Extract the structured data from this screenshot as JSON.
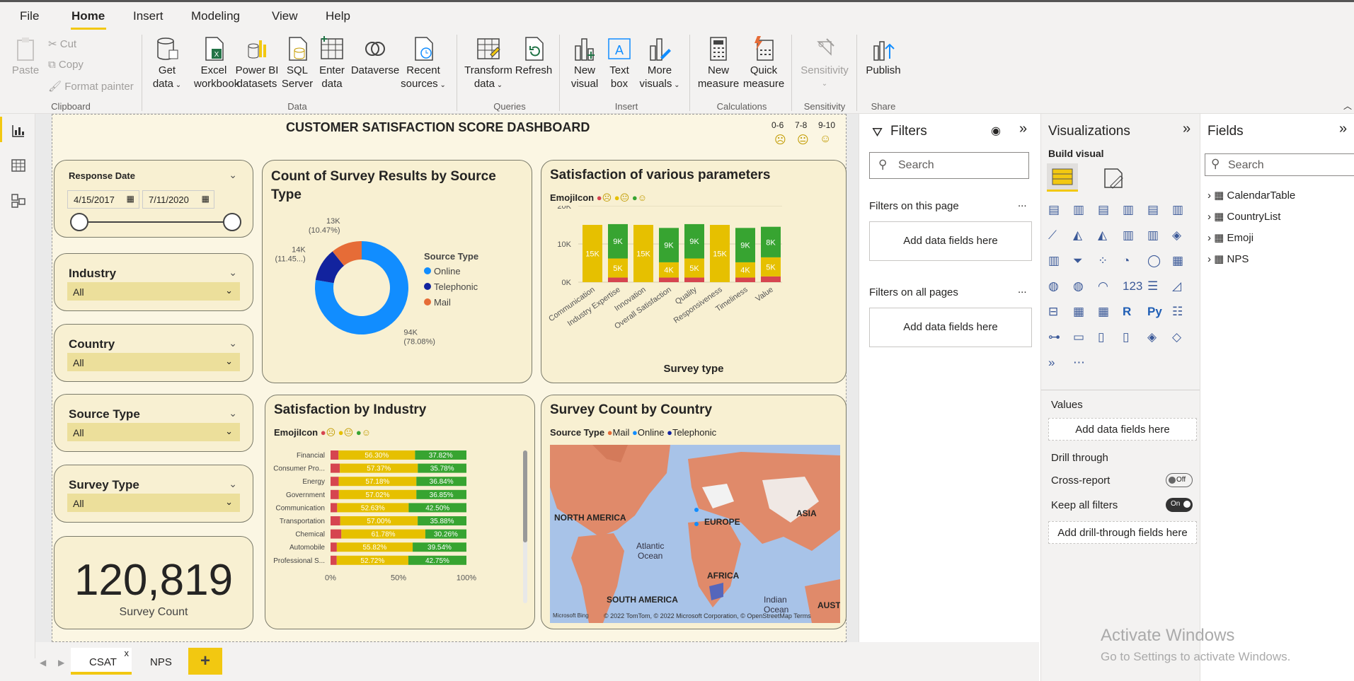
{
  "menu": {
    "items": [
      "File",
      "Home",
      "Insert",
      "Modeling",
      "View",
      "Help"
    ]
  },
  "ribbon": {
    "clipboard": {
      "paste": "Paste",
      "cut": "Cut",
      "copy": "Copy",
      "format_painter": "Format painter",
      "group": "Clipboard"
    },
    "data": {
      "get_data": [
        "Get",
        "data"
      ],
      "excel": [
        "Excel",
        "workbook"
      ],
      "powerbi": [
        "Power BI",
        "datasets"
      ],
      "sql": [
        "SQL",
        "Server"
      ],
      "enter": [
        "Enter",
        "data"
      ],
      "dataverse": "Dataverse",
      "recent": [
        "Recent",
        "sources"
      ],
      "group": "Data"
    },
    "queries": {
      "transform": [
        "Transform",
        "data"
      ],
      "refresh": "Refresh",
      "group": "Queries"
    },
    "insert": {
      "new_visual": [
        "New",
        "visual"
      ],
      "text_box": [
        "Text",
        "box"
      ],
      "more_visuals": [
        "More",
        "visuals"
      ],
      "group": "Insert"
    },
    "calculations": {
      "new_measure": [
        "New",
        "measure"
      ],
      "quick_measure": [
        "Quick",
        "measure"
      ],
      "group": "Calculations"
    },
    "sensitivity": {
      "label": "Sensitivity",
      "group": "Sensitivity"
    },
    "share": {
      "publish": "Publish",
      "group": "Share"
    }
  },
  "dashboard": {
    "title": "CUSTOMER SATISFACTION SCORE DASHBOARD",
    "legend_ranges": [
      "0-6",
      "7-8",
      "9-10"
    ],
    "slicers": {
      "date": {
        "title": "Response Date",
        "from": "4/15/2017",
        "to": "7/11/2020"
      },
      "industry": {
        "title": "Industry",
        "value": "All"
      },
      "country": {
        "title": "Country",
        "value": "All"
      },
      "source_type": {
        "title": "Source Type",
        "value": "All"
      },
      "survey_type": {
        "title": "Survey Type",
        "value": "All"
      }
    },
    "kpi": {
      "value": "120,819",
      "label": "Survey Count"
    }
  },
  "chart_data": [
    {
      "type": "pie",
      "title": "Count of Survey Results by Source Type",
      "legend_title": "Source Type",
      "categories": [
        "Online",
        "Telephonic",
        "Mail"
      ],
      "values": [
        94000,
        14000,
        13000
      ],
      "labels": [
        {
          "v": "94K",
          "p": "(78.08%)"
        },
        {
          "v": "14K",
          "p": "(11.45...)"
        },
        {
          "v": "13K",
          "p": "(10.47%)"
        }
      ],
      "colors": [
        "#118dff",
        "#12239e",
        "#e66c37"
      ]
    },
    {
      "type": "bar",
      "title": "Satisfaction of various parameters",
      "legend_title": "EmojiIcon",
      "xlabel": "Survey type",
      "categories": [
        "Communication",
        "Industry Expertise",
        "Innovation",
        "Overall Satisfaction",
        "Quality",
        "Responsiveness",
        "Timeliness",
        "Value"
      ],
      "ylim": [
        0,
        20000
      ],
      "yticks": [
        "0K",
        "10K",
        "20K"
      ],
      "series": [
        {
          "values": [
            0,
            1200,
            0,
            1200,
            1200,
            0,
            1200,
            1500
          ],
          "color": "#d64550"
        },
        {
          "values": [
            15000,
            5000,
            15000,
            4000,
            5000,
            15000,
            4000,
            5000
          ],
          "color": "#e6c000"
        },
        {
          "values": [
            0,
            9000,
            0,
            9000,
            9000,
            0,
            9000,
            8000
          ],
          "color": "#37a431"
        }
      ],
      "data_labels": [
        [
          "",
          "15K",
          ""
        ],
        [
          "",
          "5K",
          "9K"
        ],
        [
          "",
          "15K",
          ""
        ],
        [
          "",
          "4K",
          "9K"
        ],
        [
          "",
          "5K",
          "9K"
        ],
        [
          "",
          "15K",
          ""
        ],
        [
          "",
          "4K",
          "9K"
        ],
        [
          "",
          "5K",
          "8K"
        ]
      ]
    },
    {
      "type": "bar",
      "title": "Satisfaction by Industry",
      "legend_title": "EmojiIcon",
      "categories": [
        "Financial",
        "Consumer Pro...",
        "Energy",
        "Government",
        "Communication",
        "Transportation",
        "Chemical",
        "Automobile",
        "Professional S..."
      ],
      "xticks": [
        "0%",
        "50%",
        "100%"
      ],
      "series": [
        {
          "values": [
            5.88,
            6.85,
            5.98,
            6.13,
            4.87,
            7.12,
            7.96,
            4.62,
            4.53
          ],
          "color": "#d64550"
        },
        {
          "values": [
            56.3,
            57.37,
            57.18,
            57.02,
            52.63,
            57.0,
            61.78,
            55.82,
            52.72
          ],
          "labels": [
            "56.30%",
            "57.37%",
            "57.18%",
            "57.02%",
            "52.63%",
            "57.00%",
            "61.78%",
            "55.82%",
            "52.72%"
          ],
          "color": "#e6c000"
        },
        {
          "values": [
            37.82,
            35.78,
            36.84,
            36.85,
            42.5,
            35.88,
            30.26,
            39.54,
            42.75
          ],
          "labels": [
            "37.82%",
            "35.78%",
            "36.84%",
            "36.85%",
            "42.50%",
            "35.88%",
            "30.26%",
            "39.54%",
            "42.75%"
          ],
          "color": "#37a431"
        }
      ]
    }
  ],
  "map": {
    "title": "Survey Count by Country",
    "legend_title": "Source Type",
    "legend": [
      {
        "name": "Mail",
        "color": "#e66c37"
      },
      {
        "name": "Online",
        "color": "#118dff"
      },
      {
        "name": "Telephonic",
        "color": "#12239e"
      }
    ],
    "labels": [
      "NORTH AMERICA",
      "EUROPE",
      "ASIA",
      "Atlantic",
      "Ocean",
      "AFRICA",
      "SOUTH AMERICA",
      "Indian",
      "Ocean",
      "AUST"
    ],
    "credit": "© 2022 TomTom, © 2022 Microsoft Corporation, © OpenStreetMap  Terms",
    "bing": "Microsoft Bing"
  },
  "filters": {
    "title": "Filters",
    "search": "Search",
    "on_page": "Filters on this page",
    "on_all": "Filters on all pages",
    "add": "Add data fields here",
    "more": "..."
  },
  "viz": {
    "title": "Visualizations",
    "build": "Build visual",
    "values": "Values",
    "add": "Add data fields here",
    "drill": "Drill through",
    "cross": "Cross-report",
    "cross_state": "Off",
    "keep": "Keep all filters",
    "keep_state": "On",
    "add_drill": "Add drill-through fields here"
  },
  "fields": {
    "title": "Fields",
    "search": "Search",
    "tables": [
      "CalendarTable",
      "CountryList",
      "Emoji",
      "NPS"
    ]
  },
  "tabs": {
    "items": [
      "CSAT",
      "NPS"
    ],
    "close": "x",
    "add": "+"
  },
  "watermark": {
    "line1": "Activate Windows",
    "line2": "Go to Settings to activate Windows."
  }
}
